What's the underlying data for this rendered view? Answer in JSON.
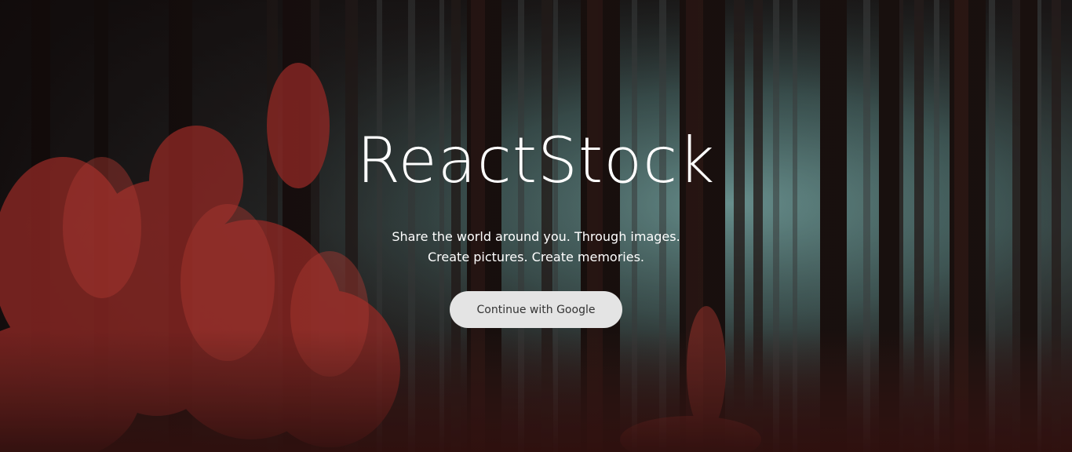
{
  "hero": {
    "title": "ReactStock",
    "tagline_line1": "Share the world around you. Through images.",
    "tagline_line2": "Create pictures. Create memories.",
    "cta_label": "Continue with Google"
  },
  "colors": {
    "title_text": "#ffffff",
    "button_bg": "#e4e4e4",
    "button_text": "#333333",
    "fog": "#8fc7c4",
    "foliage": "#b3322d",
    "trunk": "#2a1a18"
  },
  "background_image": "red-forest-fog-photo"
}
